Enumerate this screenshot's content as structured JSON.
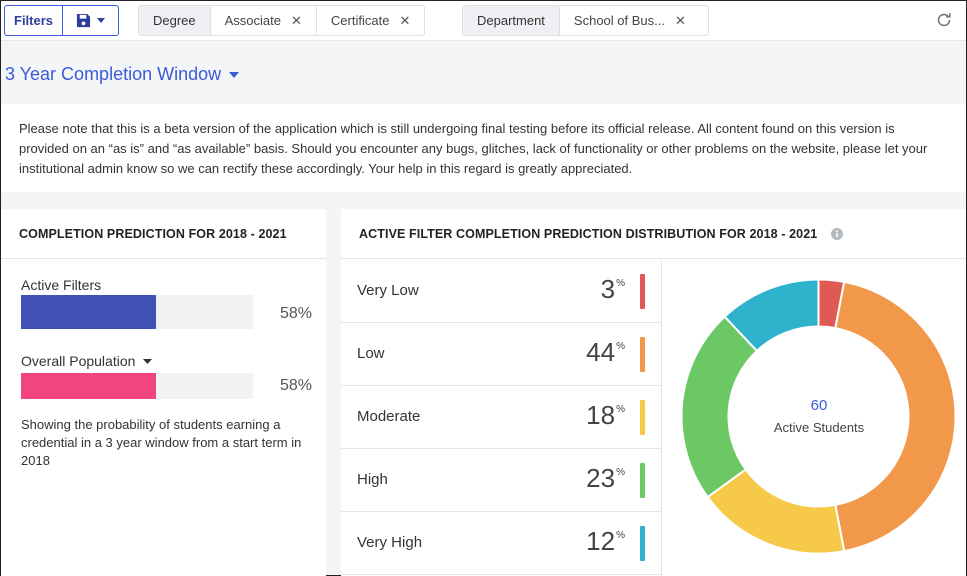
{
  "filterbar": {
    "filters_label": "Filters",
    "chips_degree": {
      "key": "Degree",
      "values": [
        "Associate",
        "Certificate"
      ]
    },
    "chips_department": {
      "key": "Department",
      "values": [
        "School of Bus..."
      ]
    }
  },
  "window_title": "3 Year Completion Window",
  "notice": "Please note that this is a beta version of the application which is still undergoing final testing before its official release. All content found on this version is provided on an “as is” and “as available” basis. Should you encounter any bugs, glitches, lack of functionality or other problems on the website, please let your institutional admin know so we can rectify these accordingly. Your help in this regard is greatly appreciated.",
  "left_panel": {
    "title": "COMPLETION PREDICTION FOR 2018 - 2021",
    "active_label": "Active Filters",
    "active_pct": "58%",
    "active_value": 0.58,
    "population_label": "Overall Population",
    "population_pct": "58%",
    "population_value": 0.58,
    "description": "Showing the probability of students earning a credential in a 3 year window from a start term in 2018"
  },
  "right_panel": {
    "title": "ACTIVE FILTER COMPLETION PREDICTION DISTRIBUTION FOR 2018 - 2021",
    "total": "60",
    "total_label": "Active Students"
  },
  "chart_data": {
    "type": "pie",
    "categories": [
      "Very Low",
      "Low",
      "Moderate",
      "High",
      "Very High"
    ],
    "values": [
      3,
      44,
      18,
      23,
      12
    ],
    "value_labels": [
      "3",
      "44",
      "18",
      "23",
      "12"
    ],
    "unit": "%",
    "colors": [
      "#e05a55",
      "#f2984a",
      "#f7c948",
      "#6cc765",
      "#2fb3cc"
    ]
  },
  "colors": {
    "accent": "#3b5bdb",
    "active_bar": "#3f51b5",
    "population_bar": "#f2457f"
  }
}
